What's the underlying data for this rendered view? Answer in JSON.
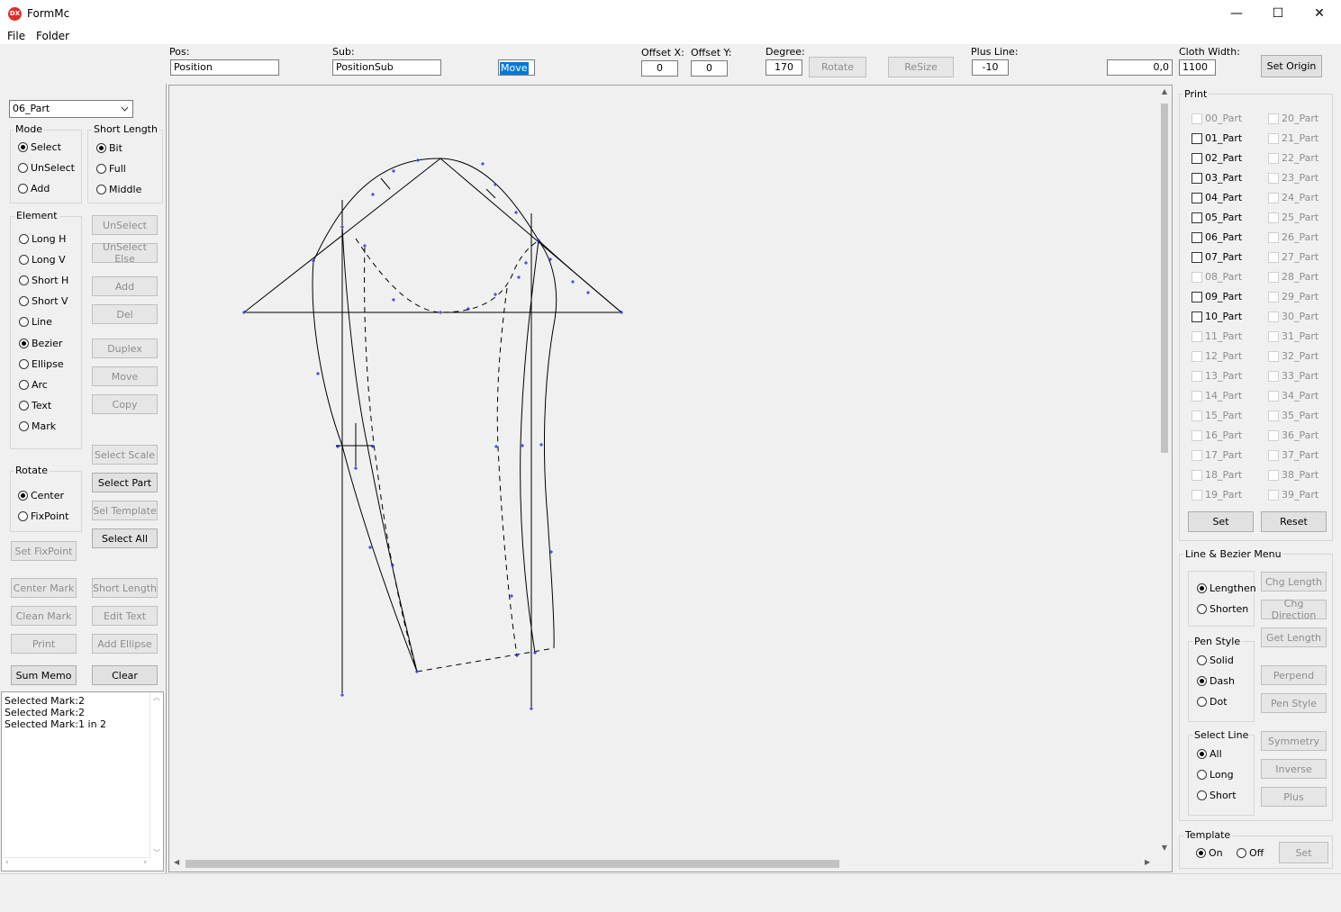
{
  "window": {
    "title": "FormMc",
    "icon_text": "DX",
    "minimize": "—",
    "maximize": "☐",
    "close": "✕"
  },
  "menu": {
    "file": "File",
    "folder": "Folder"
  },
  "toolbar": {
    "pos_label": "Pos:",
    "pos_value": "Position",
    "sub_label": "Sub:",
    "sub_value": "PositionSub",
    "move_value": "Move",
    "offset_x_label": "Offset X:",
    "offset_x_value": "0",
    "offset_y_label": "Offset Y:",
    "offset_y_value": "0",
    "degree_label": "Degree:",
    "degree_value": "170",
    "rotate_button": "Rotate",
    "resize_button": "ReSize",
    "plus_line_label": "Plus Line:",
    "plus_line_value": "-10",
    "coord_value": "0,0",
    "cloth_width_label": "Cloth Width:",
    "cloth_width_value": "1100",
    "set_origin_button": "Set Origin"
  },
  "left": {
    "part_select": "06_Part",
    "mode": {
      "title": "Mode",
      "options": [
        "Select",
        "UnSelect",
        "Add"
      ],
      "selected": "Select"
    },
    "short_length": {
      "title": "Short Length",
      "options": [
        "Bit",
        "Full",
        "Middle"
      ],
      "selected": "Bit"
    },
    "element": {
      "title": "Element",
      "options": [
        "Long H",
        "Long V",
        "Short H",
        "Short V",
        "Line",
        "Bezier",
        "Ellipse",
        "Arc",
        "Text",
        "Mark"
      ],
      "selected": "Bezier"
    },
    "rotate": {
      "title": "Rotate",
      "options": [
        "Center",
        "FixPoint"
      ],
      "selected": "Center"
    },
    "buttons": {
      "unselect": "UnSelect",
      "unselect_else": "UnSelect Else",
      "add": "Add",
      "del": "Del",
      "duplex": "Duplex",
      "move": "Move",
      "copy": "Copy",
      "select_scale": "Select Scale",
      "select_part": "Select Part",
      "sel_template": "Sel Template",
      "select_all": "Select All",
      "set_fixpoint": "Set FixPoint",
      "center_mark": "Center Mark",
      "short_length": "Short Length",
      "clean_mark": "Clean Mark",
      "edit_text": "Edit Text",
      "print": "Print",
      "add_ellipse": "Add Ellipse",
      "sum_memo": "Sum Memo",
      "clear": "Clear"
    },
    "memo_lines": [
      "Selected Mark:2",
      "Selected Mark:2",
      "Selected Mark:1 in 2"
    ]
  },
  "right": {
    "print_title": "Print",
    "parts_col1": [
      "00_Part",
      "01_Part",
      "02_Part",
      "03_Part",
      "04_Part",
      "05_Part",
      "06_Part",
      "07_Part",
      "08_Part",
      "09_Part",
      "10_Part",
      "11_Part",
      "12_Part",
      "13_Part",
      "14_Part",
      "15_Part",
      "16_Part",
      "17_Part",
      "18_Part",
      "19_Part"
    ],
    "parts_col2": [
      "20_Part",
      "21_Part",
      "22_Part",
      "23_Part",
      "24_Part",
      "25_Part",
      "26_Part",
      "27_Part",
      "28_Part",
      "29_Part",
      "30_Part",
      "31_Part",
      "32_Part",
      "33_Part",
      "34_Part",
      "35_Part",
      "36_Part",
      "37_Part",
      "38_Part",
      "39_Part"
    ],
    "enabled_parts": [
      "01_Part",
      "02_Part",
      "03_Part",
      "04_Part",
      "05_Part",
      "06_Part",
      "07_Part",
      "09_Part",
      "10_Part"
    ],
    "set_button": "Set",
    "reset_button": "Reset",
    "line_bezier_title": "Line & Bezier Menu",
    "length_options": [
      "Lengthen",
      "Shorten"
    ],
    "length_selected": "Lengthen",
    "pen_style": {
      "title": "Pen Style",
      "options": [
        "Solid",
        "Dash",
        "Dot"
      ],
      "selected": "Dash"
    },
    "select_line": {
      "title": "Select Line",
      "options": [
        "All",
        "Long",
        "Short"
      ],
      "selected": "All"
    },
    "buttons": {
      "chg_length": "Chg Length",
      "chg_direction": "Chg Direction",
      "get_length": "Get Length",
      "perpend": "Perpend",
      "pen_style": "Pen Style",
      "symmetry": "Symmetry",
      "inverse": "Inverse",
      "plus": "Plus"
    },
    "template": {
      "title": "Template",
      "on": "On",
      "off": "Off",
      "selected": "On",
      "set_button": "Set"
    }
  },
  "canvas": {
    "line_color": "#000000",
    "mark_color": "#1a2bd6",
    "scroll_up": "▲",
    "scroll_down": "▼",
    "scroll_left": "◀",
    "scroll_right": "▶"
  }
}
